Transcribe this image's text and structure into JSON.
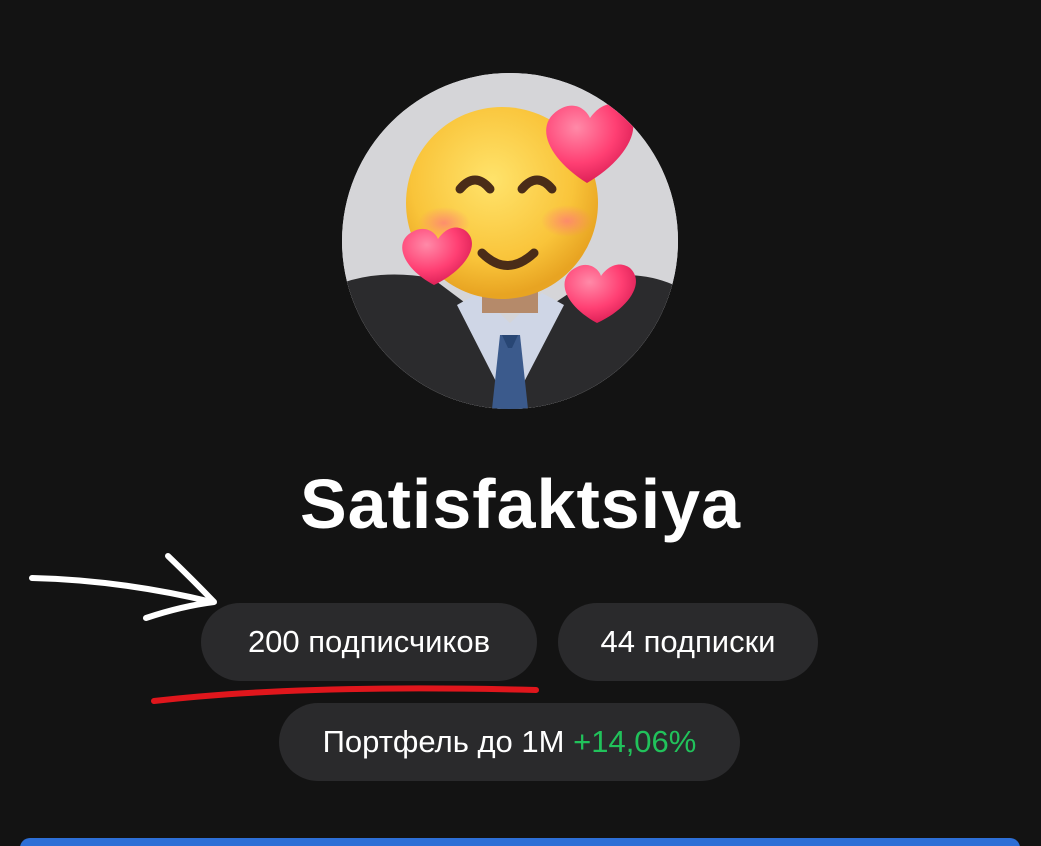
{
  "profile": {
    "name": "Satisfaktsiya",
    "avatar_icon": "avatar-photo-with-smiling-hearts-emoji"
  },
  "stats": {
    "followers_label": "200 подписчиков",
    "following_label": "44 подписки"
  },
  "portfolio": {
    "label": "Портфель до 1M",
    "change": "+14,06%",
    "change_color": "#21c25b"
  },
  "annotations": {
    "arrow_icon": "hand-drawn-arrow-icon",
    "underline_color": "#e0161c"
  },
  "colors": {
    "background": "#131313",
    "chip_background": "#2a2a2c",
    "accent_blue": "#2d6fd6"
  }
}
